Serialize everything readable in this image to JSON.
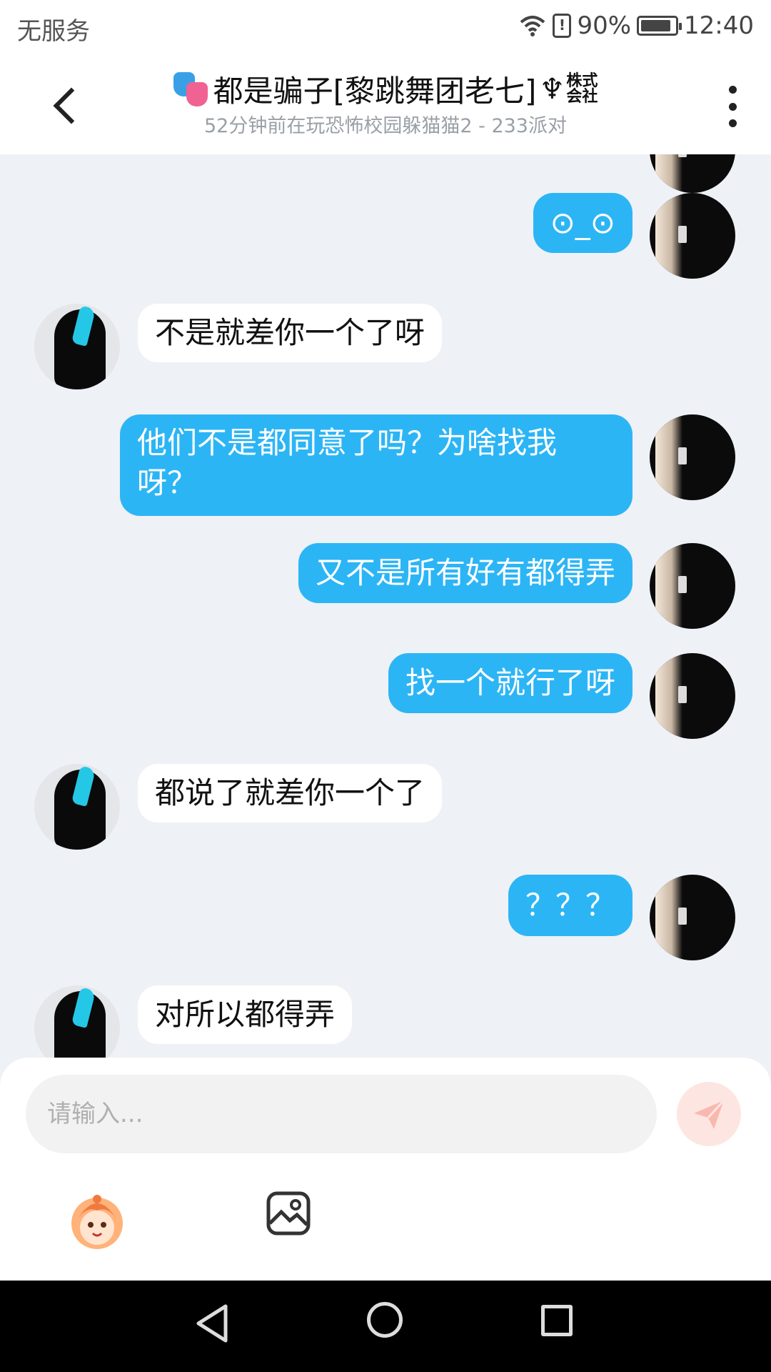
{
  "status_bar": {
    "carrier": "无服务",
    "battery_percent": "90%",
    "battery_level": 0.9,
    "time": "12:40",
    "alert_glyph": "!"
  },
  "header": {
    "title": "都是骗子[黎跳舞团老七]",
    "badge_symbol": "♆",
    "badge_line1": "株式",
    "badge_line2": "会社",
    "subtitle": "52分钟前在玩恐怖校园躲猫猫2 - 233派对",
    "icons": [
      "back-arrow-icon",
      "drama-mask-icon",
      "more-vertical-icon"
    ]
  },
  "messages": [
    {
      "sender": "me",
      "text": "⊙_⊙"
    },
    {
      "sender": "other",
      "text": "不是就差你一个了呀"
    },
    {
      "sender": "me",
      "text": "他们不是都同意了吗？为啥找我呀？"
    },
    {
      "sender": "me",
      "text": "又不是所有好有都得弄"
    },
    {
      "sender": "me",
      "text": "找一个就行了呀"
    },
    {
      "sender": "other",
      "text": "都说了就差你一个了"
    },
    {
      "sender": "me",
      "text": "？？？"
    },
    {
      "sender": "other",
      "text": "对所以都得弄"
    }
  ],
  "input": {
    "placeholder": "请输入...",
    "send_icon": "send-icon",
    "tools": [
      "emoji-icon",
      "image-icon"
    ]
  },
  "colors": {
    "my_bubble": "#2cb5f5",
    "other_bubble": "#ffffff",
    "chat_background": "#eef1f5"
  },
  "nav_bar": [
    "back-icon",
    "home-icon",
    "recents-icon"
  ]
}
